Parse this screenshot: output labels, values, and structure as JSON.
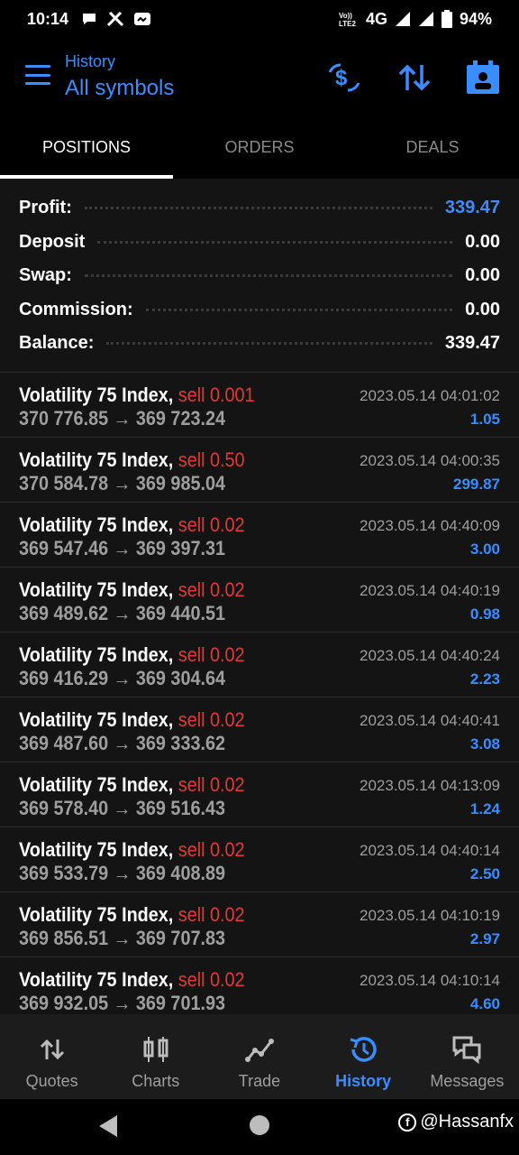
{
  "status_bar": {
    "time": "10:14",
    "network": "4G",
    "battery": "94%"
  },
  "header": {
    "subtitle": "History",
    "title": "All symbols"
  },
  "tabs": [
    {
      "label": "POSITIONS",
      "active": true
    },
    {
      "label": "ORDERS",
      "active": false
    },
    {
      "label": "DEALS",
      "active": false
    }
  ],
  "summary": {
    "profit": {
      "label": "Profit:",
      "value": "339.47"
    },
    "deposit": {
      "label": "Deposit",
      "value": "0.00"
    },
    "swap": {
      "label": "Swap:",
      "value": "0.00"
    },
    "commission": {
      "label": "Commission:",
      "value": "0.00"
    },
    "balance": {
      "label": "Balance:",
      "value": "339.47"
    }
  },
  "deals": [
    {
      "symbol": "Volatility 75 Index,",
      "side": "sell 0.001",
      "prices": "370 776.85 → 369 723.24",
      "time": "2023.05.14 04:01:02",
      "profit": "1.05"
    },
    {
      "symbol": "Volatility 75 Index,",
      "side": "sell 0.50",
      "prices": "370 584.78 → 369 985.04",
      "time": "2023.05.14 04:00:35",
      "profit": "299.87"
    },
    {
      "symbol": "Volatility 75 Index,",
      "side": "sell 0.02",
      "prices": "369 547.46 → 369 397.31",
      "time": "2023.05.14 04:40:09",
      "profit": "3.00"
    },
    {
      "symbol": "Volatility 75 Index,",
      "side": "sell 0.02",
      "prices": "369 489.62 → 369 440.51",
      "time": "2023.05.14 04:40:19",
      "profit": "0.98"
    },
    {
      "symbol": "Volatility 75 Index,",
      "side": "sell 0.02",
      "prices": "369 416.29 → 369 304.64",
      "time": "2023.05.14 04:40:24",
      "profit": "2.23"
    },
    {
      "symbol": "Volatility 75 Index,",
      "side": "sell 0.02",
      "prices": "369 487.60 → 369 333.62",
      "time": "2023.05.14 04:40:41",
      "profit": "3.08"
    },
    {
      "symbol": "Volatility 75 Index,",
      "side": "sell 0.02",
      "prices": "369 578.40 → 369 516.43",
      "time": "2023.05.14 04:13:09",
      "profit": "1.24"
    },
    {
      "symbol": "Volatility 75 Index,",
      "side": "sell 0.02",
      "prices": "369 533.79 → 369 408.89",
      "time": "2023.05.14 04:40:14",
      "profit": "2.50"
    },
    {
      "symbol": "Volatility 75 Index,",
      "side": "sell 0.02",
      "prices": "369 856.51 → 369 707.83",
      "time": "2023.05.14 04:10:19",
      "profit": "2.97"
    },
    {
      "symbol": "Volatility 75 Index,",
      "side": "sell 0.02",
      "prices": "369 932.05 → 369 701.93",
      "time": "2023.05.14 04:10:14",
      "profit": "4.60"
    }
  ],
  "bottom_nav": [
    {
      "label": "Quotes",
      "icon": "quotes-icon",
      "active": false
    },
    {
      "label": "Charts",
      "icon": "charts-icon",
      "active": false
    },
    {
      "label": "Trade",
      "icon": "trade-icon",
      "active": false
    },
    {
      "label": "History",
      "icon": "history-icon",
      "active": true
    },
    {
      "label": "Messages",
      "icon": "messages-icon",
      "active": false
    }
  ],
  "watermark": "@Hassanfx",
  "colors": {
    "accent": "#3a8dff",
    "sell": "#e53935",
    "background": "#141414"
  }
}
